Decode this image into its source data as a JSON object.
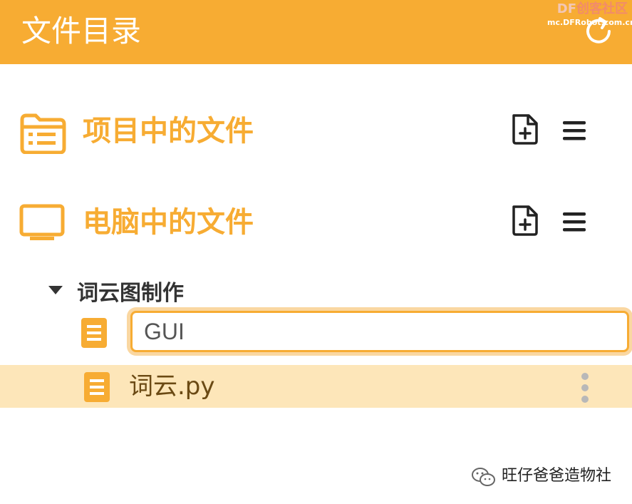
{
  "header": {
    "title": "文件目录",
    "refresh_icon": "refresh-icon"
  },
  "watermark_top": {
    "brand_df": "DF",
    "brand_cn": "创客社区",
    "url": "mc.DFRobot.com.cn"
  },
  "sections": [
    {
      "title": "项目中的文件",
      "icon": "folder-list-icon"
    },
    {
      "title": "电脑中的文件",
      "icon": "monitor-icon"
    }
  ],
  "tree": {
    "folder_name": "词云图制作",
    "new_file_input_value": "GUI",
    "files": [
      {
        "name": "词云.py",
        "icon": "document-icon"
      }
    ]
  },
  "watermark_bottom": {
    "account": "旺仔爸爸造物社"
  },
  "colors": {
    "accent": "#f7ac33",
    "header_bg": "#f7ac33",
    "selected_row": "#fde6b9",
    "icon_dark": "#222222"
  }
}
